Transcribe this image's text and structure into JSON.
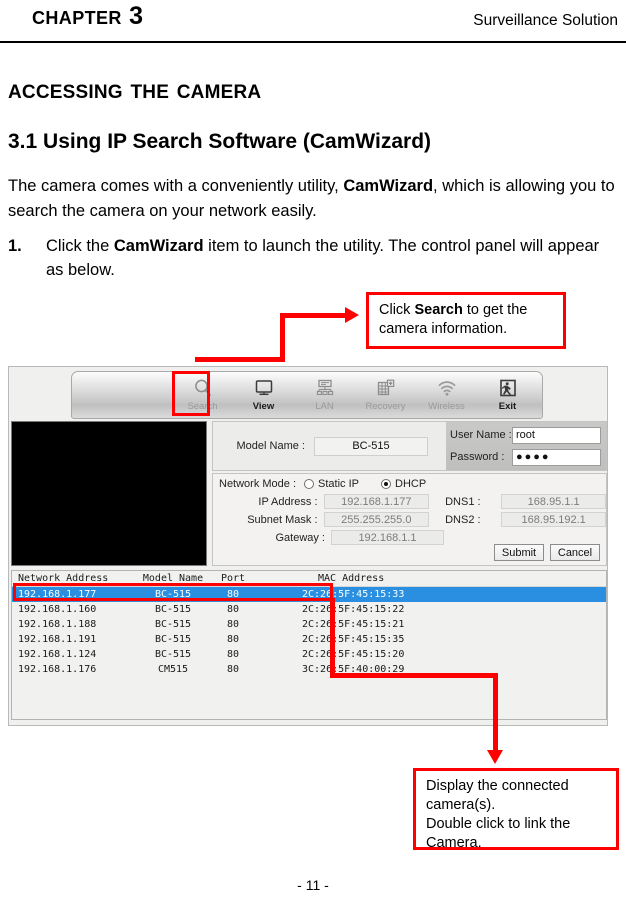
{
  "header": {
    "chapter": "Chapter 3",
    "right_title": "Surveillance Solution"
  },
  "section_title": "Accessing The Camera",
  "subsection_title": "3.1  Using IP Search Software (CamWizard)",
  "intro": {
    "part1": "The camera comes with a conveniently utility, ",
    "bold": "CamWizard",
    "part2": ", which is allowing you to search the camera on your network easily."
  },
  "step": {
    "number": "1.",
    "part1": "Click the ",
    "bold": "CamWizard",
    "part2": " item to launch the utility. The control panel will appear as below."
  },
  "callouts": {
    "search": {
      "part1": "Click ",
      "bold": "Search",
      "part2": " to get the camera information."
    },
    "display": {
      "line1": "Display the connected camera(s).",
      "line2": "Double click to link the Camera."
    }
  },
  "app": {
    "toolbar": [
      {
        "icon": "search-icon",
        "label": "Search",
        "enabled": false
      },
      {
        "icon": "monitor-icon",
        "label": "View",
        "enabled": true
      },
      {
        "icon": "lan-icon",
        "label": "LAN",
        "enabled": false
      },
      {
        "icon": "recovery-icon",
        "label": "Recovery",
        "enabled": false
      },
      {
        "icon": "wifi-icon",
        "label": "Wireless",
        "enabled": false
      },
      {
        "icon": "exit-icon",
        "label": "Exit",
        "enabled": true
      }
    ],
    "info": {
      "model_label": "Model Name :",
      "model_value": "BC-515",
      "username_label": "User Name :",
      "username_value": "root",
      "password_label": "Password :",
      "password_value": "●●●●"
    },
    "network": {
      "mode_label": "Network Mode :",
      "static_label": "Static IP",
      "dhcp_label": "DHCP",
      "selected_mode": "DHCP",
      "ip_label": "IP Address :",
      "ip_value": "192.168.1.177",
      "subnet_label": "Subnet Mask :",
      "subnet_value": "255.255.255.0",
      "gateway_label": "Gateway :",
      "gateway_value": "192.168.1.1",
      "dns1_label": "DNS1 :",
      "dns1_value": "168.95.1.1",
      "dns2_label": "DNS2 :",
      "dns2_value": "168.95.192.1",
      "submit_label": "Submit",
      "cancel_label": "Cancel"
    },
    "list": {
      "columns": [
        "Network Address",
        "Model Name",
        "Port",
        "MAC Address"
      ],
      "rows": [
        {
          "ip": "192.168.1.177",
          "model": "BC-515",
          "port": "80",
          "mac": "2C:26:5F:45:15:33",
          "selected": true
        },
        {
          "ip": "192.168.1.160",
          "model": "BC-515",
          "port": "80",
          "mac": "2C:26:5F:45:15:22",
          "selected": false
        },
        {
          "ip": "192.168.1.188",
          "model": "BC-515",
          "port": "80",
          "mac": "2C:26:5F:45:15:21",
          "selected": false
        },
        {
          "ip": "192.168.1.191",
          "model": "BC-515",
          "port": "80",
          "mac": "2C:26:5F:45:15:35",
          "selected": false
        },
        {
          "ip": "192.168.1.124",
          "model": "BC-515",
          "port": "80",
          "mac": "2C:26:5F:45:15:20",
          "selected": false
        },
        {
          "ip": "192.168.1.176",
          "model": "CM515",
          "port": "80",
          "mac": "3C:26:5F:40:00:29",
          "selected": false
        }
      ]
    }
  },
  "footer": "- 11 -",
  "colors": {
    "annotation_red": "#fe0000",
    "selection_blue": "#2a8fe0"
  }
}
